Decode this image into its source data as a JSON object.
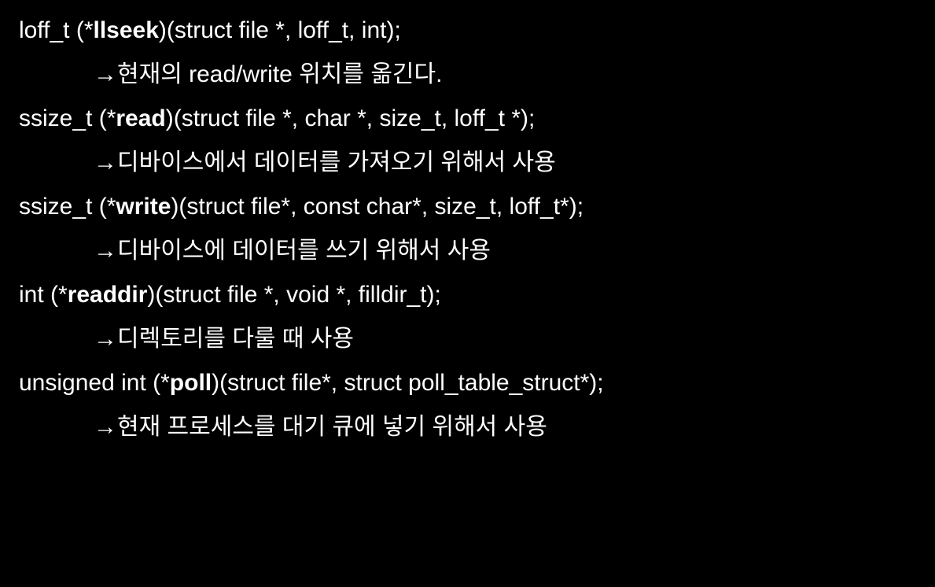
{
  "entries": [
    {
      "sig_pre": "loff_t (*",
      "sig_bold": "llseek",
      "sig_post": ")(struct file *, loff_t, int);",
      "desc": "현재의 read/write 위치를 옮긴다."
    },
    {
      "sig_pre": "ssize_t (*",
      "sig_bold": "read",
      "sig_post": ")(struct file *, char *, size_t, loff_t *);",
      "desc": "디바이스에서 데이터를 가져오기 위해서 사용"
    },
    {
      "sig_pre": "ssize_t (*",
      "sig_bold": "write",
      "sig_post": ")(struct file*, const char*, size_t, loff_t*);",
      "desc": "디바이스에 데이터를 쓰기 위해서 사용"
    },
    {
      "sig_pre": "int (*",
      "sig_bold": "readdir",
      "sig_post": ")(struct file *, void *, filldir_t);",
      "desc": "디렉토리를 다룰 때 사용"
    },
    {
      "sig_pre": "unsigned int (*",
      "sig_bold": "poll",
      "sig_post": ")(struct file*, struct poll_table_struct*);",
      "desc": "현재 프로세스를 대기 큐에 넣기 위해서 사용"
    }
  ],
  "arrow": "→"
}
